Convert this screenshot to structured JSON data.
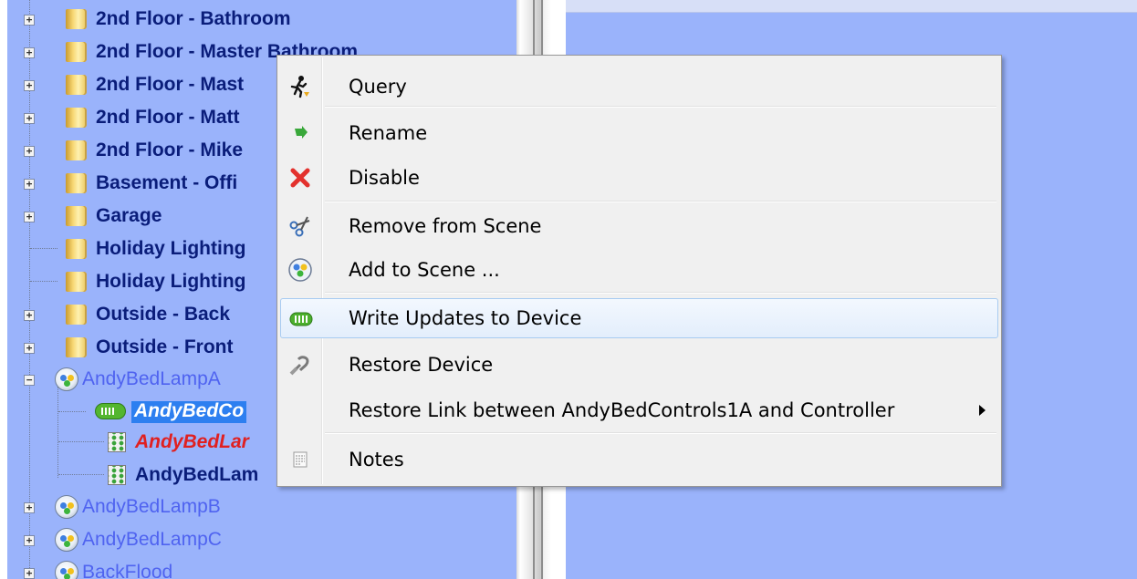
{
  "tree": {
    "items": [
      {
        "label": "2nd Floor - Bathroom",
        "type": "folder"
      },
      {
        "label": "2nd Floor - Master Bathroom",
        "type": "folder"
      },
      {
        "label": "2nd Floor - Mast",
        "type": "folder"
      },
      {
        "label": "2nd Floor - Matt",
        "type": "folder"
      },
      {
        "label": "2nd Floor - Mike",
        "type": "folder"
      },
      {
        "label": "Basement - Offi",
        "type": "folder"
      },
      {
        "label": "Garage",
        "type": "folder"
      },
      {
        "label": "Holiday Lighting",
        "type": "folder"
      },
      {
        "label": "Holiday Lighting",
        "type": "folder"
      },
      {
        "label": "Outside - Back",
        "type": "folder"
      },
      {
        "label": "Outside - Front",
        "type": "folder"
      },
      {
        "label": "AndyBedLampA",
        "type": "scene"
      },
      {
        "label": "AndyBedCo",
        "type": "device",
        "state": "selected"
      },
      {
        "label": "AndyBedLar",
        "type": "keypad",
        "state": "error"
      },
      {
        "label": "AndyBedLam",
        "type": "keypad"
      },
      {
        "label": "AndyBedLampB",
        "type": "scene"
      },
      {
        "label": "AndyBedLampC",
        "type": "scene"
      },
      {
        "label": "BackFlood",
        "type": "scene"
      }
    ]
  },
  "context_menu": {
    "items": [
      {
        "label": "Query",
        "icon": "running-man-icon"
      },
      {
        "label": "Rename",
        "icon": "green-arrow-icon"
      },
      {
        "label": "Disable",
        "icon": "red-x-icon"
      },
      {
        "label": "Remove from Scene",
        "icon": "scissors-icon"
      },
      {
        "label": "Add to Scene ...",
        "icon": "scene-icon"
      },
      {
        "label": "Write Updates to Device",
        "icon": "device-icon"
      },
      {
        "label": "Restore Device",
        "icon": "restore-icon"
      },
      {
        "label": "Restore Link between AndyBedControls1A and Controller",
        "icon": "",
        "has_submenu": true
      },
      {
        "label": "Notes",
        "icon": "notes-icon"
      }
    ],
    "highlighted": "Write Updates to Device"
  },
  "colors": {
    "pane_bg": "#9ab3fb",
    "folder_text": "#0a1d7a",
    "scene_text": "#4f63f0",
    "selected_bg": "#2d7ff0",
    "error_text": "#e02020",
    "menu_bg": "#f0f0f0"
  }
}
